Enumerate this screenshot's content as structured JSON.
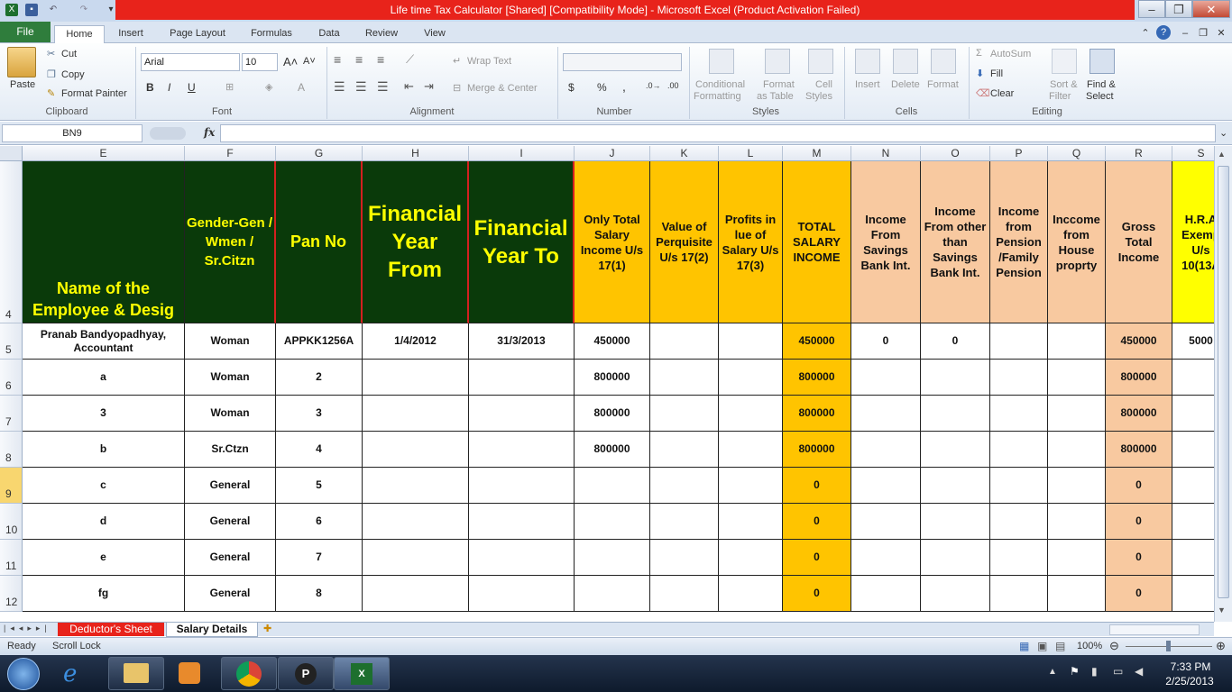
{
  "window": {
    "title": "Life time Tax Calculator  [Shared]  [Compatibility Mode]  -  Microsoft Excel (Product Activation Failed)"
  },
  "tabs": {
    "file": "File",
    "home": "Home",
    "insert": "Insert",
    "page_layout": "Page Layout",
    "formulas": "Formulas",
    "data": "Data",
    "review": "Review",
    "view": "View"
  },
  "ribbon": {
    "clipboard": {
      "paste": "Paste",
      "cut": "Cut",
      "copy": "Copy",
      "format_painter": "Format Painter",
      "label": "Clipboard"
    },
    "font": {
      "name": "Arial",
      "size": "10",
      "label": "Font",
      "bold": "B",
      "italic": "I",
      "underline": "U"
    },
    "alignment": {
      "wrap": "Wrap Text",
      "merge": "Merge & Center",
      "label": "Alignment"
    },
    "number": {
      "label": "Number",
      "currency": "$",
      "percent": "%",
      "comma": ","
    },
    "styles": {
      "conditional1": "Conditional",
      "conditional2": "Formatting",
      "format_table1": "Format",
      "format_table2": "as Table",
      "cell_styles1": "Cell",
      "cell_styles2": "Styles",
      "label": "Styles"
    },
    "cells": {
      "insert": "Insert",
      "delete": "Delete",
      "format": "Format",
      "label": "Cells"
    },
    "editing": {
      "autosum": "AutoSum",
      "fill": "Fill",
      "clear": "Clear",
      "sort1": "Sort &",
      "sort2": "Filter",
      "find1": "Find &",
      "find2": "Select",
      "label": "Editing"
    }
  },
  "formula_bar": {
    "name_box": "BN9",
    "fx": "fx",
    "content": ""
  },
  "columns": [
    "E",
    "F",
    "G",
    "H",
    "I",
    "J",
    "K",
    "L",
    "M",
    "N",
    "O",
    "P",
    "Q",
    "R",
    "S"
  ],
  "rows": [
    "4",
    "5",
    "6",
    "7",
    "8",
    "9",
    "10",
    "11",
    "12"
  ],
  "header_row": {
    "E": "Name of the Employee & Desig",
    "F": "Gender-Gen / Wmen / Sr.Citzn",
    "G": "Pan No",
    "H": "Financial Year From",
    "I": "Financial Year To",
    "J": "Only Total Salary Income U/s 17(1)",
    "K": "Value of Perquisite U/s 17(2)",
    "L": "Profits in lue of Salary U/s 17(3)",
    "M": "TOTAL SALARY INCOME",
    "N": "Income From Savings Bank Int.",
    "O": "Income From other than Savings Bank Int.",
    "P": "Income from Pension /Family Pension",
    "Q": "Inccome from House proprty",
    "R": "Gross Total Income",
    "S": "H.R.A Exemp U/s 10(13A"
  },
  "data_rows": [
    {
      "E": "Pranab Bandyopadhyay, Accountant",
      "F": "Woman",
      "G": "APPKK1256A",
      "H": "1/4/2012",
      "I": "31/3/2013",
      "J": "450000",
      "K": "",
      "L": "",
      "M": "450000",
      "N": "0",
      "O": "0",
      "P": "",
      "Q": "",
      "R": "450000",
      "S": "5000"
    },
    {
      "E": "a",
      "F": "Woman",
      "G": "2",
      "H": "",
      "I": "",
      "J": "800000",
      "K": "",
      "L": "",
      "M": "800000",
      "N": "",
      "O": "",
      "P": "",
      "Q": "",
      "R": "800000",
      "S": ""
    },
    {
      "E": "3",
      "F": "Woman",
      "G": "3",
      "H": "",
      "I": "",
      "J": "800000",
      "K": "",
      "L": "",
      "M": "800000",
      "N": "",
      "O": "",
      "P": "",
      "Q": "",
      "R": "800000",
      "S": ""
    },
    {
      "E": "b",
      "F": "Sr.Ctzn",
      "G": "4",
      "H": "",
      "I": "",
      "J": "800000",
      "K": "",
      "L": "",
      "M": "800000",
      "N": "",
      "O": "",
      "P": "",
      "Q": "",
      "R": "800000",
      "S": ""
    },
    {
      "E": "c",
      "F": "General",
      "G": "5",
      "H": "",
      "I": "",
      "J": "",
      "K": "",
      "L": "",
      "M": "0",
      "N": "",
      "O": "",
      "P": "",
      "Q": "",
      "R": "0",
      "S": ""
    },
    {
      "E": "d",
      "F": "General",
      "G": "6",
      "H": "",
      "I": "",
      "J": "",
      "K": "",
      "L": "",
      "M": "0",
      "N": "",
      "O": "",
      "P": "",
      "Q": "",
      "R": "0",
      "S": ""
    },
    {
      "E": "e",
      "F": "General",
      "G": "7",
      "H": "",
      "I": "",
      "J": "",
      "K": "",
      "L": "",
      "M": "0",
      "N": "",
      "O": "",
      "P": "",
      "Q": "",
      "R": "0",
      "S": ""
    },
    {
      "E": "fg",
      "F": "General",
      "G": "8",
      "H": "",
      "I": "",
      "J": "",
      "K": "",
      "L": "",
      "M": "0",
      "N": "",
      "O": "",
      "P": "",
      "Q": "",
      "R": "0",
      "S": ""
    }
  ],
  "sheet_tabs": {
    "deductor": "Deductor's Sheet",
    "salary": "Salary Details"
  },
  "status": {
    "ready": "Ready",
    "scroll_lock": "Scroll Lock",
    "zoom": "100%"
  },
  "taskbar": {
    "time": "7:33 PM",
    "date": "2/25/2013"
  },
  "colors": {
    "green": "#0a3a0a",
    "gold": "#ffc400",
    "peach": "#f8c9a0",
    "yellow": "#ffff00",
    "title_red": "#e8231b"
  }
}
